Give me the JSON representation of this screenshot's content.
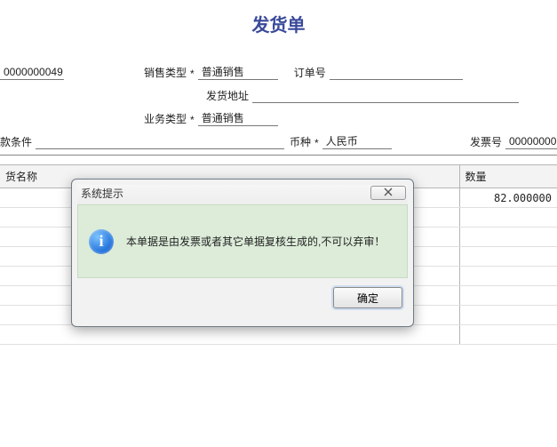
{
  "page": {
    "title": "发货单"
  },
  "form": {
    "doc_no": "0000000049",
    "sale_type_label": "销售类型",
    "sale_type_value": "普通销售",
    "order_no_label": "订单号",
    "order_no_value": "",
    "ship_addr_label": "发货地址",
    "ship_addr_value": "",
    "biz_type_label": "业务类型",
    "biz_type_value": "普通销售",
    "terms_label": "款条件",
    "terms_value": "",
    "currency_label": "币种",
    "currency_value": "人民币",
    "invoice_no_label": "发票号",
    "invoice_no_value": "00000000"
  },
  "star": "*",
  "grid": {
    "col_name": "货名称",
    "col_qty": "数量",
    "rows": [
      {
        "name": "",
        "qty": "82.000000"
      },
      {
        "name": "",
        "qty": ""
      },
      {
        "name": "",
        "qty": ""
      },
      {
        "name": "",
        "qty": ""
      },
      {
        "name": "",
        "qty": ""
      },
      {
        "name": "",
        "qty": ""
      },
      {
        "name": "",
        "qty": ""
      },
      {
        "name": "",
        "qty": ""
      }
    ]
  },
  "dialog": {
    "title": "系统提示",
    "message": "本单据是由发票或者其它单据复核生成的,不可以弃审！",
    "ok": "确定"
  }
}
